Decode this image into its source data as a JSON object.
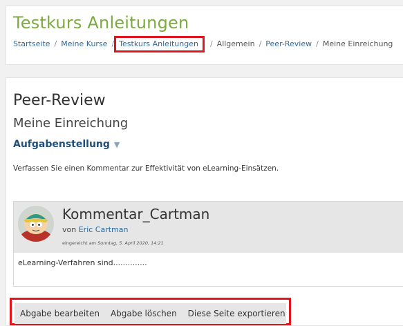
{
  "header": {
    "course_title": "Testkurs Anleitungen",
    "breadcrumb": [
      {
        "label": "Startseite"
      },
      {
        "label": "Meine Kurse"
      },
      {
        "label": "Testkurs Anleitungen"
      },
      {
        "label": "Allgemein"
      },
      {
        "label": "Peer-Review"
      },
      {
        "label": "Meine Einreichung"
      }
    ],
    "separator": "/"
  },
  "main": {
    "activity_title": "Peer-Review",
    "page_title": "Meine Einreichung",
    "task_heading": "Aufgabenstellung",
    "task_toggle_icon": "chevron-down-icon",
    "task_text": "Verfassen Sie einen Kommentar zur Effektivität von eLearning-Einsätzen.",
    "submission": {
      "title": "Kommentar_Cartman",
      "by_prefix": "von",
      "author": "Eric Cartman",
      "submitted_prefix": "eingereicht am",
      "submitted_date": "Sonntag, 5. April 2020, 14:21",
      "body": "eLearning-Verfahren sind..............",
      "avatar_icon": "user-avatar"
    },
    "actions": {
      "edit": "Abgabe bearbeiten",
      "delete": "Abgabe löschen",
      "export": "Diese Seite exportieren"
    }
  },
  "colors": {
    "course_title": "#7bab3f",
    "link": "#2c6aa0",
    "highlight_border": "#e0141c",
    "heading_blue": "#1f4f7c"
  }
}
